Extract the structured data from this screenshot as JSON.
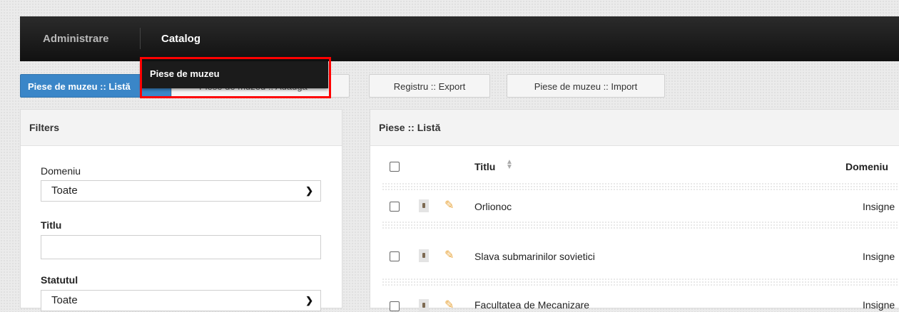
{
  "nav": {
    "items": [
      "Administrare",
      "Catalog"
    ],
    "dropdown_item": "Piese de muzeu"
  },
  "toolbar": {
    "list": "Piese de muzeu :: Listă",
    "add": "Piese de muzeu :: Adaugă",
    "export": "Registru :: Export",
    "import": "Piese de muzeu :: Import"
  },
  "filters": {
    "title": "Filters",
    "domeniu_label": "Domeniu",
    "domeniu_value": "Toate",
    "titlu_label": "Titlu",
    "statutul_label": "Statutul",
    "statutul_value": "Toate"
  },
  "list": {
    "title": "Piese :: Listă",
    "columns": [
      "Titlu",
      "Domeniu"
    ],
    "rows": [
      {
        "title": "Orlionoc",
        "domain": "Insigne"
      },
      {
        "title": "Slava submarinilor sovietici",
        "domain": "Insigne"
      },
      {
        "title": "Facultatea de Mecanizare",
        "domain": "Insigne"
      }
    ]
  },
  "icons": {
    "thumbnail": "image-thumbnail-icon",
    "edit": "pencil-icon",
    "sort": "sort-icon",
    "dropdown": "chevron-down-icon"
  },
  "colors": {
    "navbar": "#1a1a1a",
    "primary_button": "#3a86c8",
    "highlight": "#ff0000"
  }
}
